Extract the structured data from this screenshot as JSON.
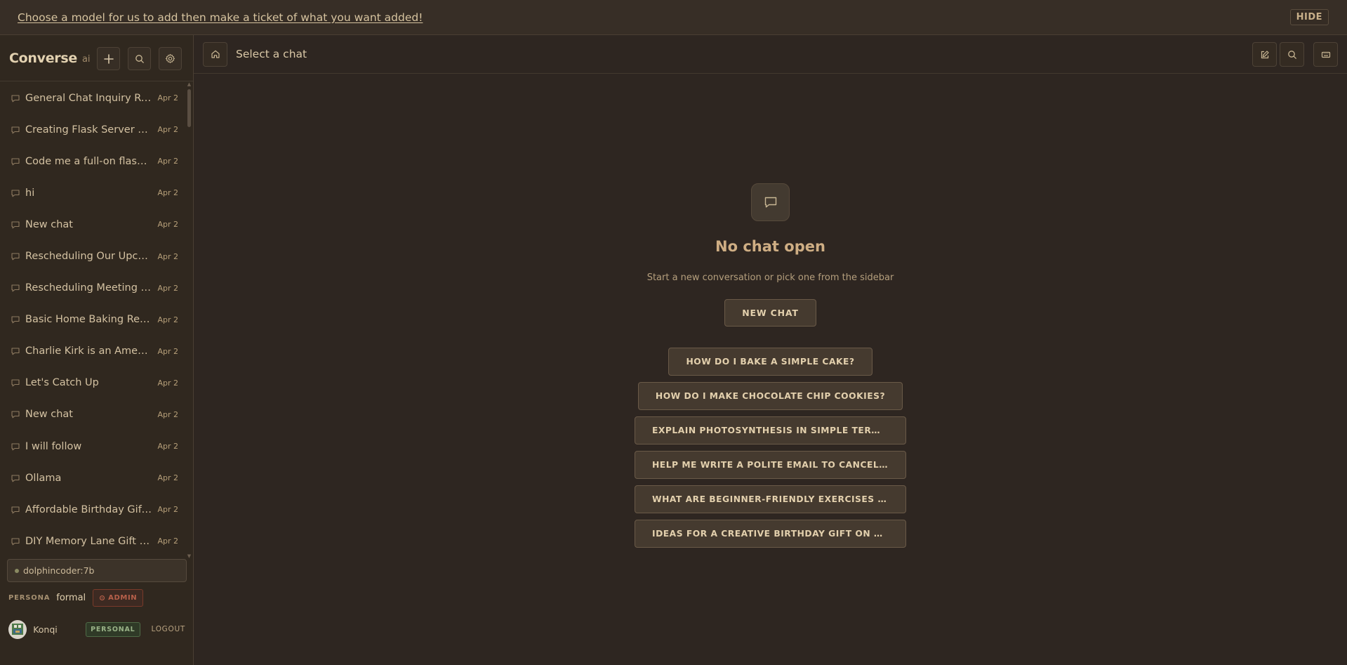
{
  "banner": {
    "message": "Choose a model for us to add then make a ticket of what you want added!",
    "hide_label": "HIDE"
  },
  "sidebar": {
    "brand": "Converse",
    "brand_sub": "ai",
    "buttons": [
      "plus-icon",
      "search-icon",
      "gear-icon"
    ],
    "chats": [
      {
        "title": "General Chat Inquiry Re...",
        "date": "Apr 2"
      },
      {
        "title": "Creating Flask Server Wit...",
        "date": "Apr 2"
      },
      {
        "title": "Code me a full-on flask ...",
        "date": "Apr 2"
      },
      {
        "title": "hi",
        "date": "Apr 2"
      },
      {
        "title": "New chat",
        "date": "Apr 2"
      },
      {
        "title": "Rescheduling Our Upco...",
        "date": "Apr 2"
      },
      {
        "title": "Rescheduling Meeting R...",
        "date": "Apr 2"
      },
      {
        "title": "Basic Home Baking Reci...",
        "date": "Apr 2"
      },
      {
        "title": "Charlie Kirk is an Americ...",
        "date": "Apr 2"
      },
      {
        "title": "Let's Catch Up",
        "date": "Apr 2"
      },
      {
        "title": "New chat",
        "date": "Apr 2"
      },
      {
        "title": "I will follow",
        "date": "Apr 2"
      },
      {
        "title": "Ollama",
        "date": "Apr 2"
      },
      {
        "title": "Affordable Birthday Gift I...",
        "date": "Apr 2"
      },
      {
        "title": "DIY Memory Lane Gift Box",
        "date": "Apr 2"
      }
    ],
    "model": "dolphincoder:7b",
    "persona_label": "PERSONA",
    "persona_value": "formal",
    "admin_label": "ADMIN",
    "user_name": "Konqi",
    "plan_badge": "PERSONAL",
    "logout_label": "LOGOUT"
  },
  "main": {
    "header_title": "Select a chat",
    "empty_title": "No chat open",
    "empty_subtitle": "Start a new conversation or pick one from the sidebar",
    "new_chat_label": "NEW CHAT",
    "suggestions": [
      "HOW DO I BAKE A SIMPLE CAKE?",
      "HOW DO I MAKE CHOCOLATE CHIP COOKIES?",
      "EXPLAIN PHOTOSYNTHESIS IN SIMPLE TERMS.",
      "HELP ME WRITE A POLITE EMAIL TO CANCEL A MEETI...",
      "WHAT ARE BEGINNER-FRIENDLY EXERCISES AT HOME?",
      "IDEAS FOR A CREATIVE BIRTHDAY GIFT ON A BUDGET."
    ]
  },
  "colors": {
    "background": "#2e2621",
    "sidebar": "#30281f",
    "accent_text": "#cfae84",
    "admin": "#b7604a",
    "personal": "#99b287"
  }
}
